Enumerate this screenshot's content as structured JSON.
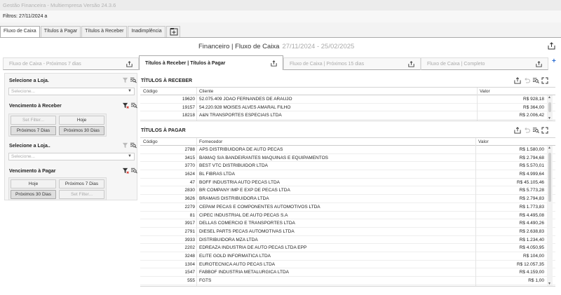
{
  "window": {
    "title": "Gestão Financeira - Multiempresa Versão 24.3.6"
  },
  "filters": {
    "label": "Filtros: 27/11/2024 a"
  },
  "main_tabs": [
    {
      "label": "Fluxo de Caixa"
    },
    {
      "label": "Títulos à Pagar"
    },
    {
      "label": "Títulos à Receber"
    },
    {
      "label": "Inadimplência"
    }
  ],
  "header": {
    "title": "Financeiro | Fluxo de Caixa",
    "period": "27/11/2024 - 25/02/2025"
  },
  "sub_tabs": [
    {
      "label": "Fluxo de Caixa - Próximos 7 dias"
    },
    {
      "label": "Títulos à Receber | Títulos à Pagar"
    },
    {
      "label": "Fluxo de Caixa | Próximos 15 dias"
    },
    {
      "label": "Fluxo de Caixa | Completo"
    }
  ],
  "sidebar": {
    "store_receber_label": "Selecione a Loja.",
    "store_receber_placeholder": "Selecione...",
    "venc_receber_label": "Vencimento à Receber",
    "venc_receber_buttons": [
      "Set Filter...",
      "Hoje",
      "Próximos 7 Dias",
      "Próximos 30 Dias"
    ],
    "store_pagar_label": "Selecione a Loja..",
    "store_pagar_placeholder": "Selecione...",
    "venc_pagar_label": "Vencimento à Pagar",
    "venc_pagar_buttons": [
      "Hoje",
      "Próximos 7 Dias",
      "Próximos 30 Dias",
      "Set Filter..."
    ]
  },
  "receber": {
    "title": "TÍTULOS À RECEBER",
    "columns": [
      "Código",
      "Cliente",
      "Valor"
    ],
    "rows": [
      {
        "codigo": "19620",
        "cliente": "52.075.409 JOAO FERNANDES DE ARAUJO",
        "valor": "R$ 928,18"
      },
      {
        "codigo": "19157",
        "cliente": "54.220.928 MOISES ALVES AMARAL FILHO",
        "valor": "R$ 364,00"
      },
      {
        "codigo": "18218",
        "cliente": "A&N TRANSPORTES ESPECIAIS LTDA",
        "valor": "R$ 2.006,42"
      }
    ]
  },
  "pagar": {
    "title": "TÍTULOS À PAGAR",
    "columns": [
      "Código",
      "Fornecedor",
      "Valor"
    ],
    "rows": [
      {
        "codigo": "2788",
        "fornecedor": "APS DISTRIBUIDORA DE AUTO PECAS",
        "valor": "R$ 1.580,00"
      },
      {
        "codigo": "3415",
        "fornecedor": "BAMAQ S/A BANDEIRANTES MAQUINAS E EQUIPAMENTOS",
        "valor": "R$ 2.794,68"
      },
      {
        "codigo": "3770",
        "fornecedor": "BEST VTC DISTRIBUIDOR LTDA",
        "valor": "R$ 5.570,01"
      },
      {
        "codigo": "1624",
        "fornecedor": "BL FIBRAS LTDA",
        "valor": "R$ 4.999,64"
      },
      {
        "codigo": "47",
        "fornecedor": "BOFF INDUSTRIA  AUTO PECAS LTDA",
        "valor": "R$ 45.105,46"
      },
      {
        "codigo": "2830",
        "fornecedor": "BR COMPANY IMP E EXP DE PECAS LTDA",
        "valor": "R$ 5.773,28"
      },
      {
        "codigo": "3626",
        "fornecedor": "BRAMAIS DISTRIBUIDORA LTDA",
        "valor": "R$ 2.794,83"
      },
      {
        "codigo": "2279",
        "fornecedor": "CEPAM PECAS E COMPONENTES AUTOMOTIVOS LTDA",
        "valor": "R$ 1.773,83"
      },
      {
        "codigo": "81",
        "fornecedor": "CIPEC INDUSTRIAL DE AUTO PECAS S.A",
        "valor": "R$ 4.495,08"
      },
      {
        "codigo": "3917",
        "fornecedor": "DELLAS COMERCIO E TRANSPORTES LTDA",
        "valor": "R$ 4.490,26"
      },
      {
        "codigo": "2791",
        "fornecedor": "DIESEL PARTS PECAS AUTOMOTIVAS LTDA",
        "valor": "R$ 2.638,83"
      },
      {
        "codigo": "3933",
        "fornecedor": "DISTRIBUIDORA MZA LTDA",
        "valor": "R$ 1.234,40"
      },
      {
        "codigo": "2202",
        "fornecedor": "EDREAZA INDUSTRIA DE AUTO PECAS LTDA EPP",
        "valor": "R$ 4.050,95"
      },
      {
        "codigo": "3248",
        "fornecedor": "ELITE GOLD INFORMATICA LTDA",
        "valor": "R$ 104,00"
      },
      {
        "codigo": "1304",
        "fornecedor": "EUROTECNICA AUTO PECAS LTDA",
        "valor": "R$ 12.057,35"
      },
      {
        "codigo": "1547",
        "fornecedor": "FABBOF INDUSTRIA METALURGICA LTDA",
        "valor": "R$ 4.159,00"
      },
      {
        "codigo": "555",
        "fornecedor": "FGTS",
        "valor": "R$ 1,00"
      }
    ]
  },
  "icons": {
    "export": "export-icon",
    "filter": "filter-icon",
    "filter_clear": "filter-clear-icon",
    "search_list": "search-list-icon",
    "undo": "undo-icon",
    "expand": "expand-icon",
    "add_tab": "add-tab-icon"
  },
  "colors": {
    "accent": "#2a6bd1",
    "clear_filter": "#d9342b"
  }
}
